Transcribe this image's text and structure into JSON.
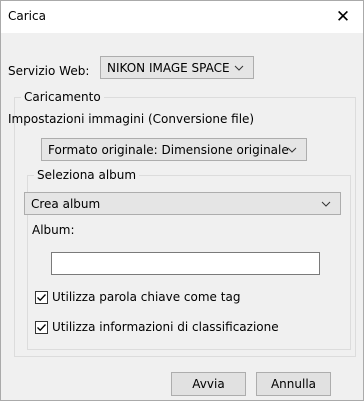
{
  "window": {
    "title": "Carica",
    "close_glyph": "✕"
  },
  "service": {
    "label": "Servizio Web:",
    "selected": "NIKON IMAGE SPACE"
  },
  "upload": {
    "legend": "Caricamento",
    "image_settings_label": "Impostazioni immagini (Conversione file)",
    "format_selected": "Formato originale: Dimensione originale"
  },
  "album": {
    "legend": "Seleziona album",
    "selected": "Crea album",
    "name_label": "Album:",
    "name_value": ""
  },
  "options": {
    "use_keyword_tag": {
      "label": "Utilizza parola chiave come tag",
      "checked": true
    },
    "use_rating_info": {
      "label": "Utilizza informazioni di classificazione",
      "checked": true
    }
  },
  "buttons": {
    "start": "Avvia",
    "cancel": "Annulla"
  },
  "icons": {
    "close": "close-icon",
    "dropdown": "chevron-down-icon",
    "checkmark": "checkmark-icon"
  }
}
